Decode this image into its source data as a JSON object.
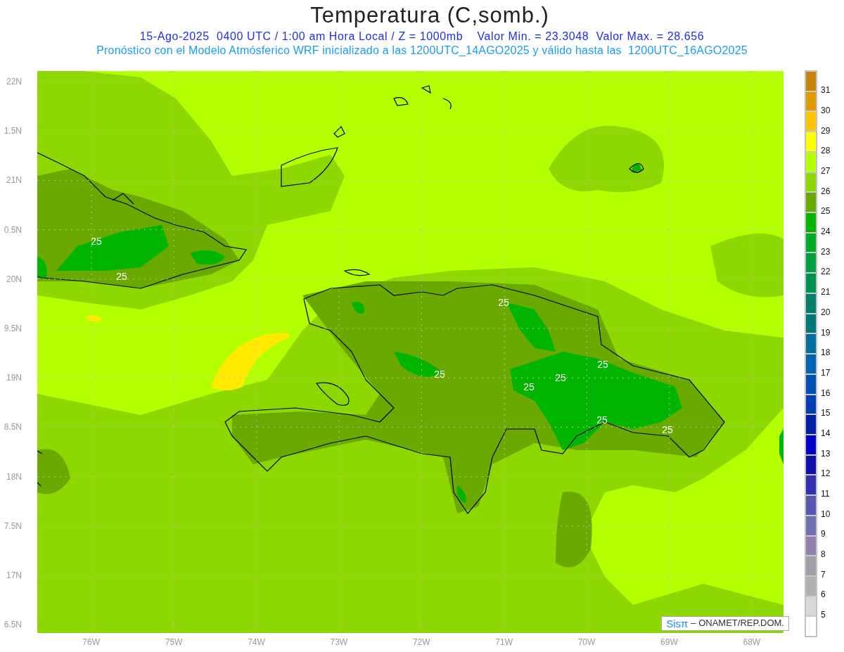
{
  "title": "Temperatura (C,somb.)",
  "subtitle": "15-Ago-2025  0400 UTC / 1:00 am Hora Local / Z = 1000mb    Valor Min. = 23.3048  Valor Max. = 28.656",
  "forecast_note": "Pronóstico con el Modelo Atmósferico WRF inicializado a las 1200UTC_14AGO2025 y válido hasta las  1200UTC_16AGO2025",
  "map": {
    "latitude_labels": [
      "22N",
      "1.5N",
      "21N",
      "0.5N",
      "20N",
      "9.5N",
      "19N",
      "8.5N",
      "18N",
      "7.5N",
      "17N",
      "6.5N"
    ],
    "longitude_labels": [
      "76W",
      "75W",
      "74W",
      "73W",
      "72W",
      "71W",
      "70W",
      "69W",
      "68W"
    ],
    "contour_labels": [
      "25",
      "25",
      "25",
      "25",
      "25",
      "25",
      "25",
      "25",
      "25"
    ]
  },
  "legend": {
    "bins": [
      {
        "color": "#c8840a"
      },
      {
        "color": "#e09a00"
      },
      {
        "color": "#ffc400"
      },
      {
        "color": "#ffff00"
      },
      {
        "color": "#b4ff00"
      },
      {
        "color": "#8cd800"
      },
      {
        "color": "#6aaa00"
      },
      {
        "color": "#00b400"
      },
      {
        "color": "#00aa28"
      },
      {
        "color": "#00a040"
      },
      {
        "color": "#009050"
      },
      {
        "color": "#00806a"
      },
      {
        "color": "#007878"
      },
      {
        "color": "#00709a"
      },
      {
        "color": "#0064b4"
      },
      {
        "color": "#0050b4"
      },
      {
        "color": "#003cb4"
      },
      {
        "color": "#0020a8"
      },
      {
        "color": "#0000c8"
      },
      {
        "color": "#1010a8"
      },
      {
        "color": "#3030b0"
      },
      {
        "color": "#5858b0"
      },
      {
        "color": "#7070b0"
      },
      {
        "color": "#9080b0"
      },
      {
        "color": "#a0a0a8"
      },
      {
        "color": "#b0b0b0"
      },
      {
        "color": "#d8d8d8"
      },
      {
        "color": "#ffffff"
      }
    ],
    "labels": [
      "31",
      "30",
      "29",
      "28",
      "27",
      "26",
      "25",
      "24",
      "23",
      "22",
      "21",
      "20",
      "19",
      "18",
      "17",
      "16",
      "15",
      "14",
      "13",
      "12",
      "11",
      "10",
      "9",
      "8",
      "7",
      "6",
      "5"
    ]
  },
  "credit": {
    "logo": "Sisπ",
    "text": "– ONAMET/REP.DOM."
  }
}
